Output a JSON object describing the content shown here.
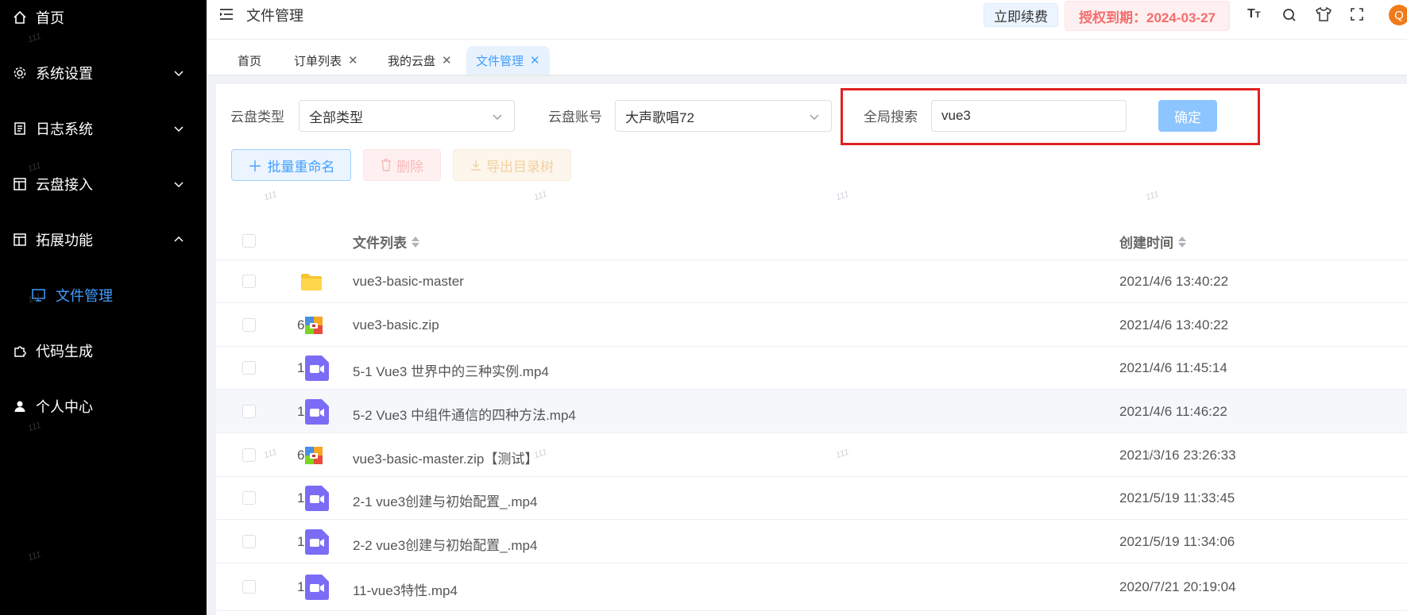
{
  "sidebar": {
    "items": [
      {
        "label": "首页",
        "icon": "home-icon"
      },
      {
        "label": "系统设置",
        "icon": "gear-icon"
      },
      {
        "label": "日志系统",
        "icon": "document-icon"
      },
      {
        "label": "云盘接入",
        "icon": "layout-icon"
      },
      {
        "label": "拓展功能",
        "icon": "layout-icon"
      },
      {
        "label": "代码生成",
        "icon": "puzzle-icon"
      },
      {
        "label": "个人中心",
        "icon": "user-icon"
      }
    ],
    "sub_item": {
      "label": "文件管理",
      "icon": "monitor-icon"
    },
    "watermark": "111"
  },
  "header": {
    "title": "文件管理",
    "renew_label": "立即续费",
    "license_label": "授权到期：2024-03-27",
    "avatar_initial": "Q"
  },
  "tabs": [
    {
      "label": "首页",
      "closable": false
    },
    {
      "label": "订单列表",
      "closable": true
    },
    {
      "label": "我的云盘",
      "closable": true
    },
    {
      "label": "文件管理",
      "closable": true,
      "active": true
    }
  ],
  "filters": {
    "type_label": "云盘类型",
    "type_value": "全部类型",
    "account_label": "云盘账号",
    "account_value": "大声歌唱72",
    "search_label": "全局搜索",
    "search_value": "vue3",
    "confirm_label": "确定"
  },
  "actions": {
    "rename_label": "批量重命名",
    "delete_label": "删除",
    "export_label": "导出目录树"
  },
  "table": {
    "col_name": "文件列表",
    "col_time": "创建时间",
    "rows": [
      {
        "prefix": "",
        "type": "folder",
        "name": "vue3-basic-master",
        "time": "2021/4/6 13:40:22"
      },
      {
        "prefix": "6",
        "type": "zip",
        "name": "vue3-basic.zip",
        "time": "2021/4/6 13:40:22"
      },
      {
        "prefix": "1",
        "type": "video",
        "name": "5-1 Vue3 世界中的三种实例.mp4",
        "time": "2021/4/6 11:45:14"
      },
      {
        "prefix": "1",
        "type": "video",
        "name": "5-2 Vue3 中组件通信的四种方法.mp4",
        "time": "2021/4/6 11:46:22"
      },
      {
        "prefix": "6",
        "type": "zip",
        "name": "vue3-basic-master.zip【测试】",
        "time": "2021/3/16 23:26:33"
      },
      {
        "prefix": "1",
        "type": "video",
        "name": "2-1 vue3创建与初始配置_.mp4",
        "time": "2021/5/19 11:33:45"
      },
      {
        "prefix": "1",
        "type": "video",
        "name": "2-2 vue3创建与初始配置_.mp4",
        "time": "2021/5/19 11:34:06"
      },
      {
        "prefix": "1",
        "type": "video",
        "name": "11-vue3特性.mp4",
        "time": "2020/7/21 20:19:04"
      }
    ]
  },
  "colors": {
    "accent": "#409eff",
    "highlight": "#e02020",
    "sidebar_bg": "#000000"
  }
}
